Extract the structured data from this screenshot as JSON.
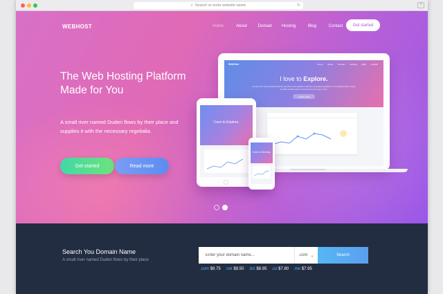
{
  "browser": {
    "address_placeholder": "Search or enter website name"
  },
  "header": {
    "logo": "WEBHOST",
    "nav": [
      {
        "label": "Home",
        "active": true
      },
      {
        "label": "About"
      },
      {
        "label": "Domain"
      },
      {
        "label": "Hosting"
      },
      {
        "label": "Blog"
      },
      {
        "label": "Contact"
      }
    ],
    "cta": "Get started"
  },
  "hero": {
    "title": "The Web Hosting Platform Made for You",
    "subtitle": "A small river named Duden flows by their place and supplies it with the necessary regelialia.",
    "primary_button": "Get started",
    "secondary_button": "Read more",
    "slides": 2,
    "active_slide": 2
  },
  "mockup": {
    "laptop_logo": "WebHost",
    "laptop_nav": [
      "Home",
      "About",
      "Domain",
      "Hosting",
      "Blog",
      "Contact"
    ],
    "laptop_title_prefix": "I love to ",
    "laptop_title_bold": "Explore.",
    "laptop_text": "A small river named Duden flows by their place and supplies it with the necessary regelialia. It is a paradisematic country, in which roasted parts of sentences fly into your mouth.",
    "laptop_button": "+ Watch Video",
    "tablet_title": "I love to Explore.",
    "phone_title": "I love to Develop."
  },
  "domain": {
    "title": "Search You Domain Name",
    "subtitle": "A small river named Duden flows by their place",
    "input_placeholder": "Enter your domain name...",
    "tld_selected": ".com",
    "search_button": "Search",
    "prices": [
      {
        "tld": ".com",
        "price": "$9.75"
      },
      {
        "tld": ".net",
        "price": "$9.50"
      },
      {
        "tld": ".biz",
        "price": "$8.95"
      },
      {
        "tld": ".co",
        "price": "$7.80"
      },
      {
        "tld": ".me",
        "price": "$7.95"
      }
    ]
  },
  "colors": {
    "hero_gradient_start": "#d870c7",
    "hero_gradient_end": "#9a58e8",
    "domain_bg": "#232d41",
    "accent_blue": "#56b7f4",
    "accent_green": "#3fd9a5"
  }
}
